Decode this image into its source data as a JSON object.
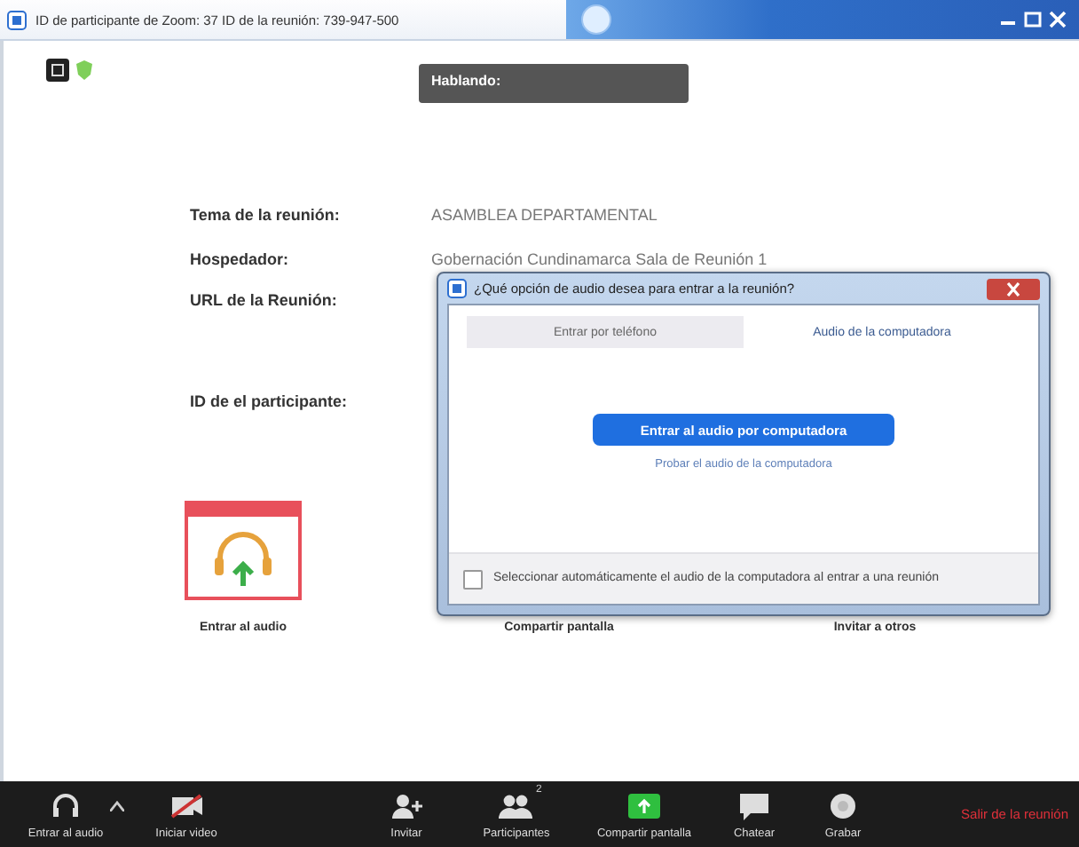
{
  "window": {
    "title": "ID de participante de Zoom: 37   ID de la reunión: 739-947-500"
  },
  "speaking_tooltip": {
    "label": "Hablando:"
  },
  "meeting_info": [
    {
      "label": "Tema de la reunión:",
      "value": "ASAMBLEA DEPARTAMENTAL"
    },
    {
      "label": "Hospedador:",
      "value": "Gobernación Cundinamarca Sala de Reunión 1"
    },
    {
      "label": "URL de la Reunión:"
    },
    {
      "label": "ID de el participante:"
    }
  ],
  "actions": [
    {
      "kind": "audio",
      "label": "Entrar al audio"
    },
    {
      "kind": "share",
      "label": "Compartir pantalla"
    },
    {
      "kind": "invite",
      "label": "Invitar a otros"
    }
  ],
  "audio_dialog": {
    "title": "¿Qué opción de audio desea para entrar a la reunión?",
    "tabs": [
      {
        "label": "Entrar por teléfono",
        "selected": false
      },
      {
        "label": "Audio de la computadora",
        "selected": true
      }
    ],
    "join_button": "Entrar al audio por computadora",
    "test_link": "Probar el audio de la computadora",
    "auto_join": {
      "label": "Seleccionar automáticamente el audio de la computadora al entrar a una reunión",
      "checked": false
    }
  },
  "toolbar": {
    "items": [
      {
        "kind": "audio",
        "label": "Entrar al audio"
      },
      {
        "kind": "video",
        "label": "Iniciar video"
      },
      {
        "kind": "invite",
        "label": "Invitar"
      },
      {
        "kind": "participants",
        "label": "Participantes",
        "count": "2"
      },
      {
        "kind": "share",
        "label": "Compartir pantalla"
      },
      {
        "kind": "chat",
        "label": "Chatear"
      },
      {
        "kind": "record",
        "label": "Grabar"
      }
    ],
    "leave": "Salir de la reunión"
  }
}
